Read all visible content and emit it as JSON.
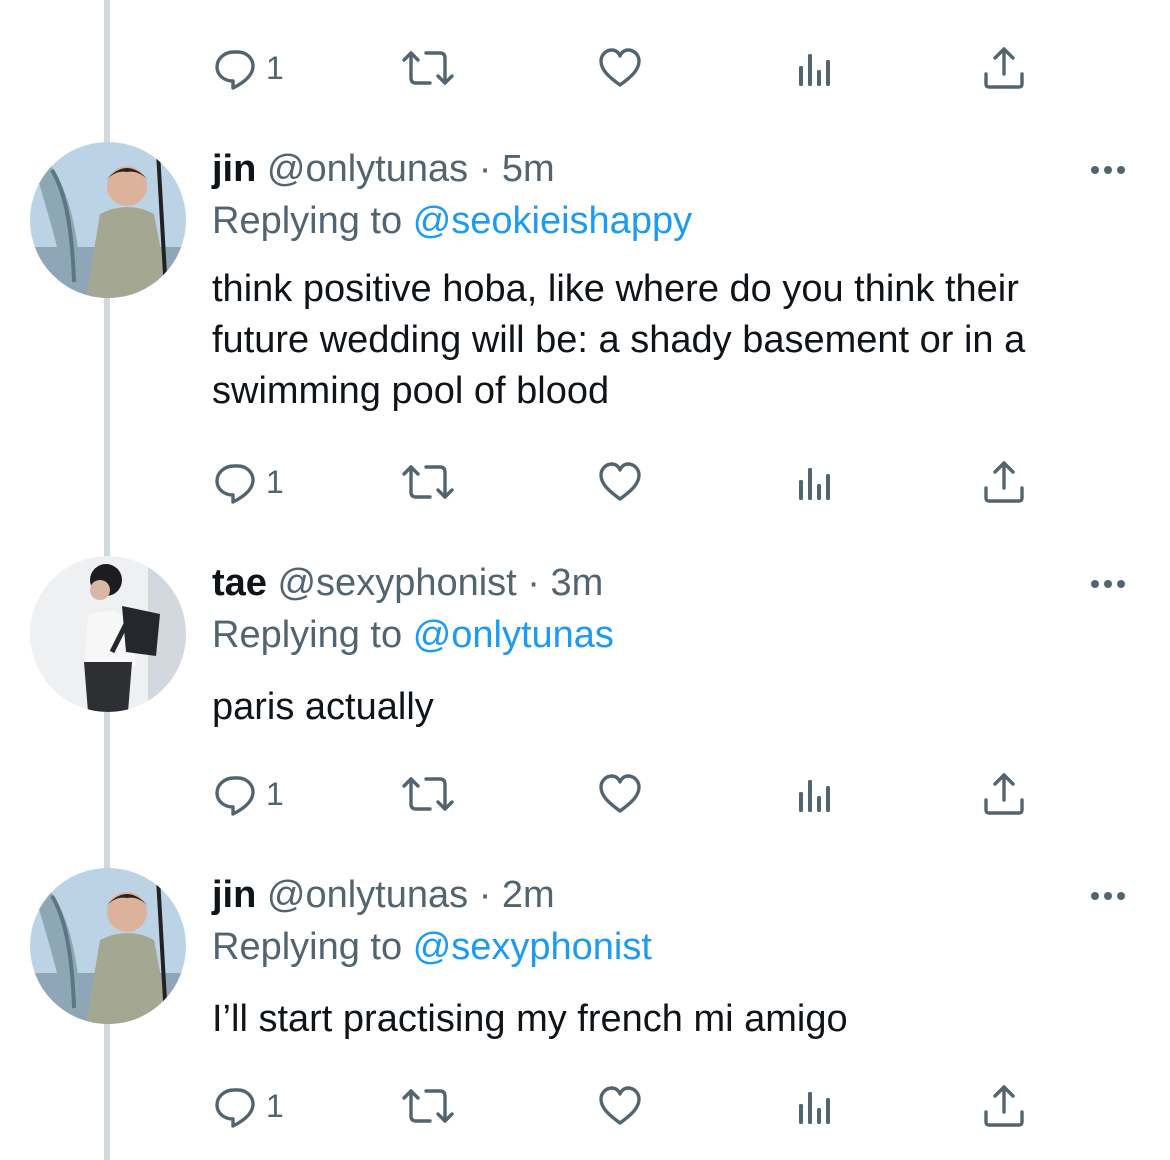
{
  "thread": {
    "top_actions": {
      "reply_count": "1"
    },
    "tweets": [
      {
        "name": "jin",
        "handle": "@onlytunas",
        "separator": "·",
        "time": "5m",
        "replying_prefix": "Replying to",
        "replying_to": "@seokieishappy",
        "text": "think positive hoba, like where do you think their future wedding will be: a shady basement or in a swimming pool of blood",
        "reply_count": "1"
      },
      {
        "name": "tae",
        "handle": "@sexyphonist",
        "separator": "·",
        "time": "3m",
        "replying_prefix": "Replying to",
        "replying_to": "@onlytunas",
        "text": "paris actually",
        "reply_count": "1"
      },
      {
        "name": "jin",
        "handle": "@onlytunas",
        "separator": "·",
        "time": "2m",
        "replying_prefix": "Replying to",
        "replying_to": "@sexyphonist",
        "text": "I’ll start practising my french mi amigo",
        "reply_count": "1"
      }
    ]
  },
  "icons": {
    "reply": "speech-bubble-icon",
    "retweet": "retweet-arrows-icon",
    "like": "heart-icon",
    "views": "bar-chart-icon",
    "share": "upload-arrow-icon",
    "more": "three-dots-icon"
  },
  "colors": {
    "text": "#0f1419",
    "secondary": "#536471",
    "mention": "#1d9bf0",
    "thread_line": "#cfd9de"
  }
}
